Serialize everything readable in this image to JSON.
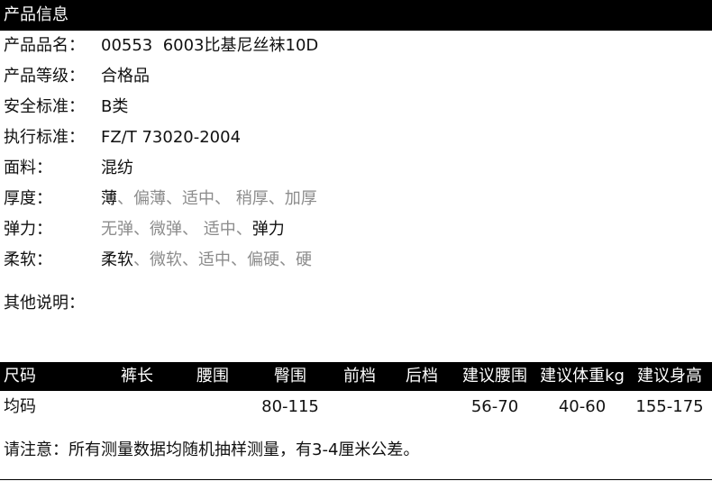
{
  "product_info": {
    "header": "产品信息",
    "rows": [
      {
        "label": "产品品名：",
        "value": "00553  6003比基尼丝袜10D"
      },
      {
        "label": "产品等级：",
        "value": "合格品"
      },
      {
        "label": "安全标准：",
        "value": "B类"
      },
      {
        "label": "执行标准：",
        "value": "FZ/T 73020-2004"
      },
      {
        "label": "面料：",
        "value": "混纺"
      }
    ],
    "scales": [
      {
        "label": "厚度：",
        "options": [
          {
            "text": "薄",
            "selected": true
          },
          {
            "text": "偏薄",
            "selected": false
          },
          {
            "text": "适中",
            "selected": false
          },
          {
            "text": " 稍厚",
            "selected": false
          },
          {
            "text": "加厚",
            "selected": false
          }
        ]
      },
      {
        "label": "弹力：",
        "options": [
          {
            "text": "无弹",
            "selected": false
          },
          {
            "text": "微弹",
            "selected": false
          },
          {
            "text": " 适中",
            "selected": false
          },
          {
            "text": "弹力",
            "selected": true
          }
        ]
      },
      {
        "label": "柔软：",
        "options": [
          {
            "text": "柔软",
            "selected": true
          },
          {
            "text": "微软",
            "selected": false
          },
          {
            "text": "适中",
            "selected": false
          },
          {
            "text": "偏硬",
            "selected": false
          },
          {
            "text": "硬",
            "selected": false
          }
        ]
      }
    ],
    "separator": "、",
    "other_label": "其他说明："
  },
  "size_table": {
    "headers": [
      "尺码",
      "裤长",
      "腰围",
      "臀围",
      "前档",
      "后档",
      "建议腰围",
      "建议体重kg",
      "建议身高"
    ],
    "rows": [
      [
        "均码",
        "",
        "",
        "80-115",
        "",
        "",
        "56-70",
        "40-60",
        "155-175"
      ]
    ]
  },
  "note": "请注意：所有测量数据均随机抽样测量，有3-4厘米公差。",
  "colors": {
    "header_bg": "#000000",
    "header_text": "#ffffff",
    "selected_text": "#111111",
    "unselected_text": "#8c8c8c"
  }
}
